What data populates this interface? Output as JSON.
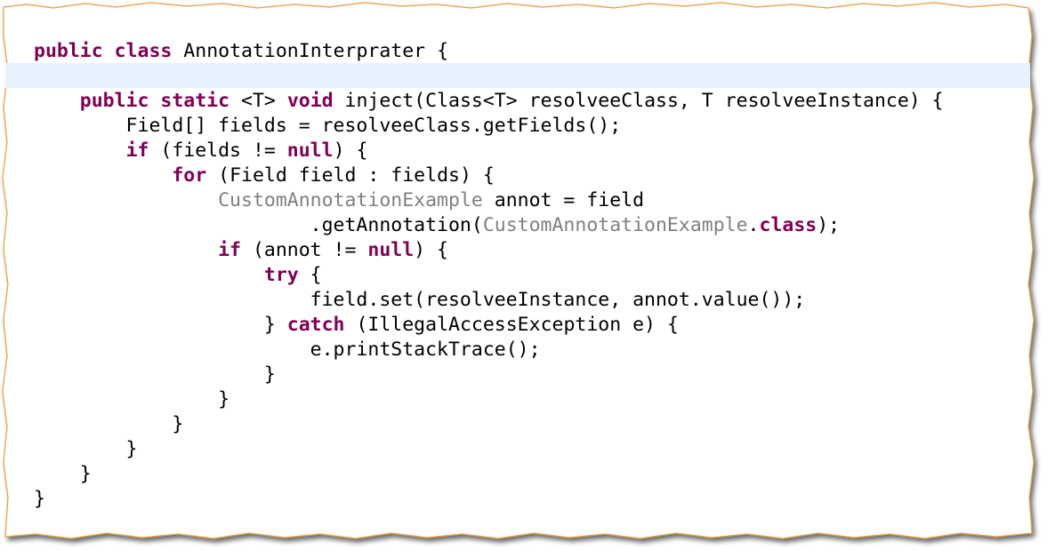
{
  "colors": {
    "keyword": "#7f0055",
    "plain": "#000000",
    "type_reference": "#808080",
    "current_line": "#e8f2fe",
    "frame_border": "#e8a040"
  },
  "code_lines": [
    [
      {
        "t": "public",
        "k": "keyword"
      },
      {
        "t": " "
      },
      {
        "t": "class",
        "k": "keyword"
      },
      {
        "t": " AnnotationInterprater {"
      }
    ],
    [
      {
        "t": ""
      }
    ],
    [
      {
        "t": "    "
      },
      {
        "t": "public",
        "k": "keyword"
      },
      {
        "t": " "
      },
      {
        "t": "static",
        "k": "keyword"
      },
      {
        "t": " <T> "
      },
      {
        "t": "void",
        "k": "keyword"
      },
      {
        "t": " inject(Class<T> resolveeClass, T resolveeInstance) {"
      }
    ],
    [
      {
        "t": "        Field[] fields = resolveeClass.getFields();"
      }
    ],
    [
      {
        "t": "        "
      },
      {
        "t": "if",
        "k": "keyword"
      },
      {
        "t": " (fields != "
      },
      {
        "t": "null",
        "k": "keyword"
      },
      {
        "t": ") {"
      }
    ],
    [
      {
        "t": "            "
      },
      {
        "t": "for",
        "k": "keyword"
      },
      {
        "t": " (Field field : fields) {"
      }
    ],
    [
      {
        "t": "                "
      },
      {
        "t": "CustomAnnotationExample",
        "k": "type_reference"
      },
      {
        "t": " annot = field"
      }
    ],
    [
      {
        "t": "                        .getAnnotation("
      },
      {
        "t": "CustomAnnotationExample",
        "k": "type_reference"
      },
      {
        "t": "."
      },
      {
        "t": "class",
        "k": "keyword"
      },
      {
        "t": ");"
      }
    ],
    [
      {
        "t": "                "
      },
      {
        "t": "if",
        "k": "keyword"
      },
      {
        "t": " (annot != "
      },
      {
        "t": "null",
        "k": "keyword"
      },
      {
        "t": ") {"
      }
    ],
    [
      {
        "t": "                    "
      },
      {
        "t": "try",
        "k": "keyword"
      },
      {
        "t": " {"
      }
    ],
    [
      {
        "t": "                        field.set(resolveeInstance, annot.value());"
      }
    ],
    [
      {
        "t": "                    } "
      },
      {
        "t": "catch",
        "k": "keyword"
      },
      {
        "t": " (IllegalAccessException e) {"
      }
    ],
    [
      {
        "t": "                        e.printStackTrace();"
      }
    ],
    [
      {
        "t": "                    }"
      }
    ],
    [
      {
        "t": "                }"
      }
    ],
    [
      {
        "t": "            }"
      }
    ],
    [
      {
        "t": "        }"
      }
    ],
    [
      {
        "t": "    }"
      }
    ],
    [
      {
        "t": "}"
      }
    ]
  ]
}
